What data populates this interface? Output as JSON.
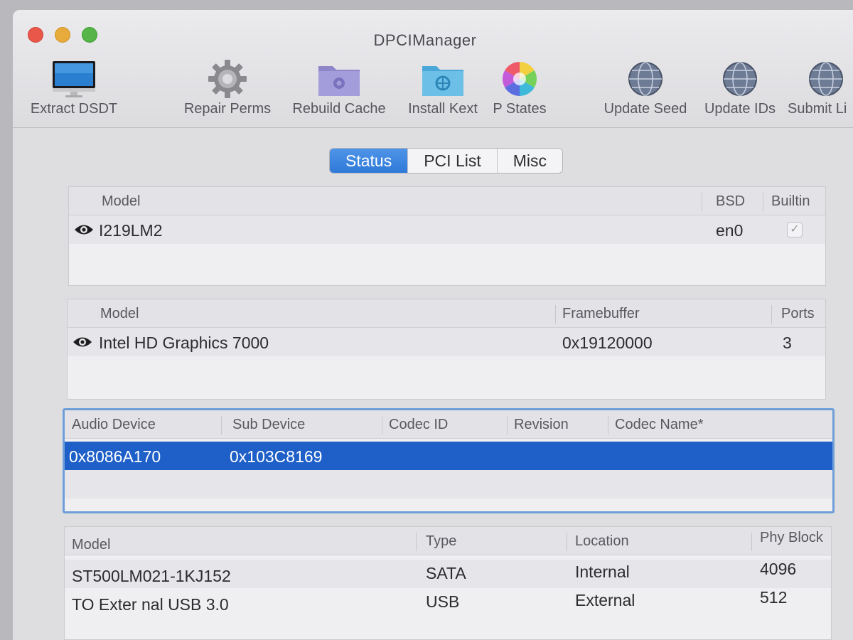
{
  "window": {
    "title": "DPCIManager"
  },
  "toolbar": [
    {
      "label": "Extract DSDT",
      "icon": "imac-icon"
    },
    {
      "label": "Repair Perms",
      "icon": "gear-icon"
    },
    {
      "label": "Rebuild Cache",
      "icon": "gear-folder-icon"
    },
    {
      "label": "Install Kext",
      "icon": "kext-folder-icon"
    },
    {
      "label": "P States",
      "icon": "color-wheel-icon"
    },
    {
      "label": "Update Seed",
      "icon": "network-globe-icon"
    },
    {
      "label": "Update IDs",
      "icon": "network-globe-icon"
    },
    {
      "label": "Submit Li",
      "icon": "network-globe-icon"
    }
  ],
  "tabs": [
    {
      "label": "Status",
      "active": true
    },
    {
      "label": "PCI List",
      "active": false
    },
    {
      "label": "Misc",
      "active": false
    }
  ],
  "network": {
    "headers": {
      "model": "Model",
      "bsd": "BSD",
      "builtin": "Builtin"
    },
    "rows": [
      {
        "model": "I219LM2",
        "bsd": "en0",
        "builtin": true
      }
    ]
  },
  "graphics": {
    "headers": {
      "model": "Model",
      "framebuffer": "Framebuffer",
      "ports": "Ports"
    },
    "rows": [
      {
        "model": "Intel HD Graphics 7000",
        "framebuffer": "0x19120000",
        "ports": "3"
      }
    ]
  },
  "audio": {
    "headers": {
      "audio_device": "Audio Device",
      "sub_device": "Sub Device",
      "codec_id": "Codec ID",
      "revision": "Revision",
      "codec_name": "Codec Name*"
    },
    "rows": [
      {
        "audio_device": "0x8086A170",
        "sub_device": "0x103C8169",
        "codec_id": "",
        "revision": "",
        "codec_name": ""
      }
    ]
  },
  "storage": {
    "headers": {
      "model": "Model",
      "type": "Type",
      "location": "Location",
      "phy_block": "Phy Block"
    },
    "rows": [
      {
        "model": "ST500LM021-1KJ152",
        "type": "SATA",
        "location": "Internal",
        "phy_block": "4096"
      },
      {
        "model": "TO Exter nal USB 3.0",
        "type": "USB",
        "location": "External",
        "phy_block": "512"
      }
    ]
  },
  "colors": {
    "accent": "#2f79d8",
    "selection": "#1e5fc8",
    "close": "#e9574b",
    "minimize": "#e7ab3b",
    "maximize": "#55b548"
  }
}
